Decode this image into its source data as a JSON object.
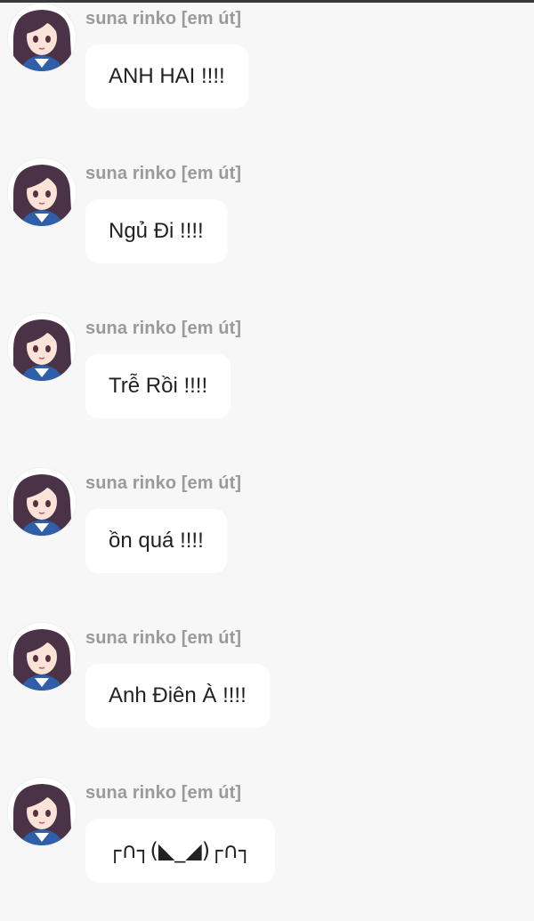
{
  "chat": {
    "messages": [
      {
        "sender": "suna rinko [em út]",
        "text": "ANH HAI !!!!"
      },
      {
        "sender": "suna rinko [em út]",
        "text": "Ngủ Đi !!!!"
      },
      {
        "sender": "suna rinko [em út]",
        "text": "Trễ Rồi !!!!"
      },
      {
        "sender": "suna rinko [em út]",
        "text": "ồn quá !!!!"
      },
      {
        "sender": "suna rinko [em út]",
        "text": "Anh Điên À !!!!"
      },
      {
        "sender": "suna rinko [em út]",
        "text": "┌∩┐(◣_◢)┌∩┐"
      }
    ]
  },
  "colors": {
    "background": "#f7f7f7",
    "bubble": "#ffffff",
    "sender": "#9a9a9a",
    "text": "#222222",
    "hair": "#4a3346"
  },
  "icons": {
    "avatar": "anime-girl-avatar"
  }
}
